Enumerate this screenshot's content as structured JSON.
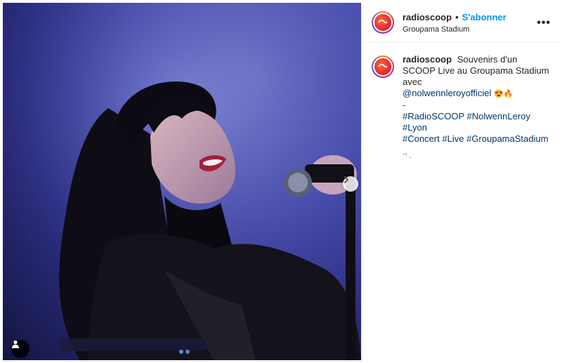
{
  "post": {
    "username": "radioscoop",
    "separator": "•",
    "follow_label": "S'abonner",
    "location": "Groupama Stadium",
    "more_label": "•••",
    "caption": {
      "text": "Souvenirs d'un SCOOP Live au Groupama Stadium avec",
      "mention": "@nolwennleroyofficiel",
      "emojis": "😍🔥",
      "dash": "-",
      "hashtags": [
        "#RadioSCOOP",
        "#NolwennLeroy",
        "#Lyon",
        "#Concert",
        "#Live",
        "#GroupamaStadium"
      ],
      "trailing": "¬ ˛"
    },
    "carousel": {
      "count": 2,
      "active_index": 0
    }
  },
  "colors": {
    "follow": "#0095f6",
    "link": "#00376b",
    "dot_active": "#3897f0"
  }
}
